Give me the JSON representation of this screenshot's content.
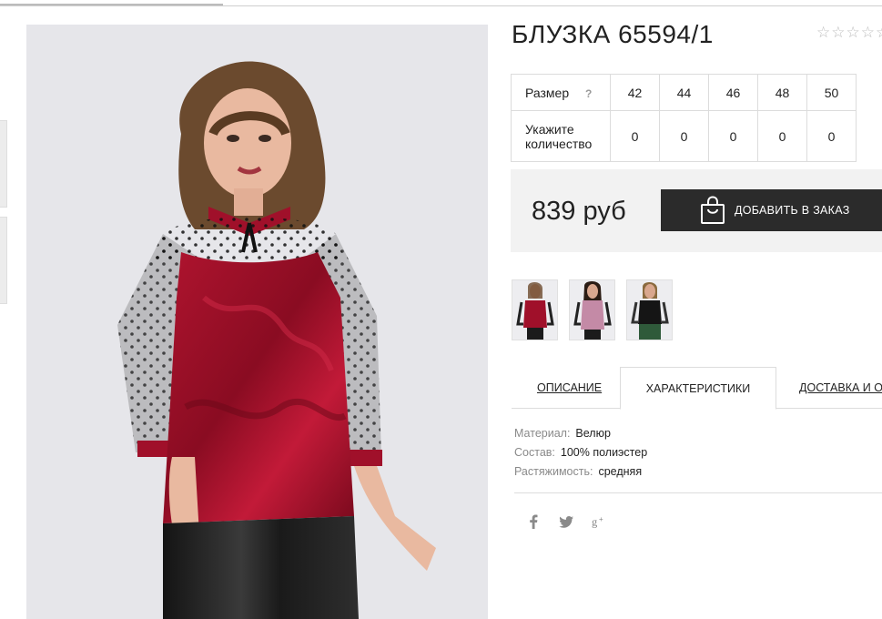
{
  "product": {
    "title": "БЛУЗКА 65594/1",
    "rating_stars": [
      "☆",
      "☆",
      "☆",
      "☆",
      "☆"
    ]
  },
  "size_table": {
    "size_label": "Размер",
    "help_mark": "?",
    "qty_label_line1": "Укажите",
    "qty_label_line2": "количество",
    "sizes": [
      "42",
      "44",
      "46",
      "48",
      "50"
    ],
    "quantities": [
      "0",
      "0",
      "0",
      "0",
      "0"
    ]
  },
  "purchase": {
    "price": "839 руб",
    "add_button_label": "ДОБАВИТЬ В ЗАКАЗ"
  },
  "tabs": {
    "description": "ОПИСАНИЕ",
    "characteristics": "ХАРАКТЕРИСТИКИ",
    "delivery": "ДОСТАВКА И ОПЛАТА",
    "active": "characteristics"
  },
  "specs": [
    {
      "key": "Материал:",
      "value": "Велюр"
    },
    {
      "key": "Состав:",
      "value": "100% полиэстер"
    },
    {
      "key": "Растяжимость:",
      "value": "средняя"
    }
  ],
  "social": {
    "facebook": "f",
    "twitter": "t",
    "googleplus": "g+"
  },
  "colors": {
    "button_bg": "#2b2b2b",
    "price_box_bg": "#f2f2f2",
    "photo_bg": "#e6e6ea",
    "velvet_red": "#a0102a",
    "icon_grey": "#8a8a8a"
  }
}
